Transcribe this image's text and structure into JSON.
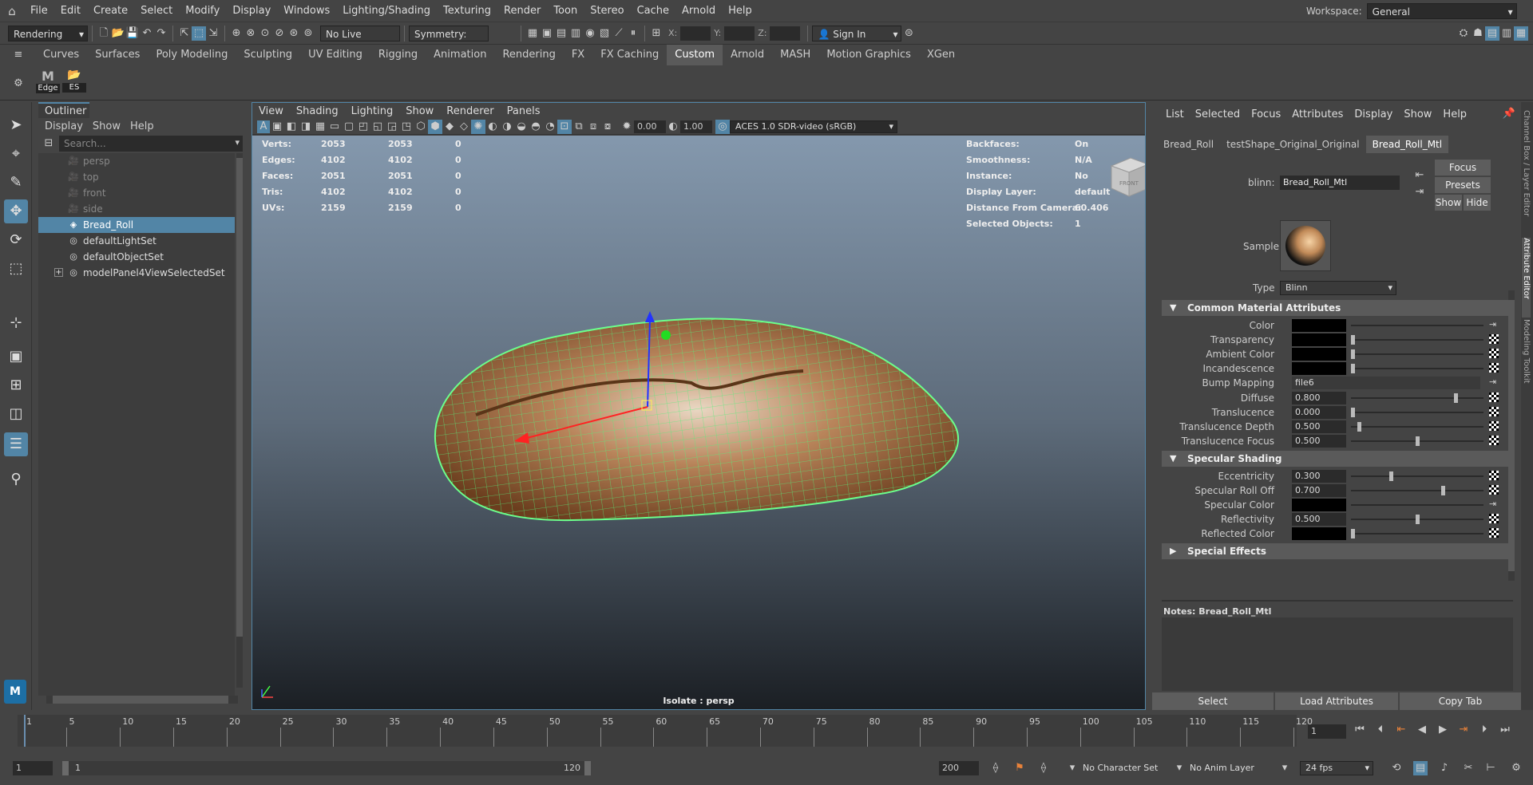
{
  "menubar": {
    "items": [
      "File",
      "Edit",
      "Create",
      "Select",
      "Modify",
      "Display",
      "Windows",
      "Lighting/Shading",
      "Texturing",
      "Render",
      "Toon",
      "Stereo",
      "Cache",
      "Arnold",
      "Help"
    ],
    "workspace_label": "Workspace:",
    "workspace_value": "General"
  },
  "statusline": {
    "menuset": "Rendering",
    "live_surface": "No Live Surface",
    "symmetry": "Symmetry: Off",
    "x_label": "X:",
    "y_label": "Y:",
    "z_label": "Z:",
    "sign_in": "Sign In"
  },
  "shelf": {
    "tabs": [
      "Curves",
      "Surfaces",
      "Poly Modeling",
      "Sculpting",
      "UV Editing",
      "Rigging",
      "Animation",
      "Rendering",
      "FX",
      "FX Caching",
      "Custom",
      "Arnold",
      "MASH",
      "Motion Graphics",
      "XGen"
    ],
    "active_tab": "Custom",
    "buttons": [
      {
        "label": "Edge",
        "glyph": "M"
      },
      {
        "label": "ES",
        "glyph": "📂"
      }
    ]
  },
  "outliner": {
    "title": "Outliner",
    "menu": [
      "Display",
      "Show",
      "Help"
    ],
    "search_placeholder": "Search...",
    "items": [
      {
        "label": "persp",
        "icon": "camera-icon",
        "dim": true
      },
      {
        "label": "top",
        "icon": "camera-icon",
        "dim": true
      },
      {
        "label": "front",
        "icon": "camera-icon",
        "dim": true
      },
      {
        "label": "side",
        "icon": "camera-icon",
        "dim": true
      },
      {
        "label": "Bread_Roll",
        "icon": "mesh-icon",
        "selected": true
      },
      {
        "label": "defaultLightSet",
        "icon": "set-icon"
      },
      {
        "label": "defaultObjectSet",
        "icon": "set-icon"
      },
      {
        "label": "modelPanel4ViewSelectedSet",
        "icon": "set-icon",
        "expand": true
      }
    ]
  },
  "viewport": {
    "menu": [
      "View",
      "Shading",
      "Lighting",
      "Show",
      "Renderer",
      "Panels"
    ],
    "exposure": "0.00",
    "gamma": "1.00",
    "colorspace": "ACES 1.0 SDR-video (sRGB)",
    "hud_left": [
      {
        "label": "Verts:",
        "a": "2053",
        "b": "2053",
        "c": "0"
      },
      {
        "label": "Edges:",
        "a": "4102",
        "b": "4102",
        "c": "0"
      },
      {
        "label": "Faces:",
        "a": "2051",
        "b": "2051",
        "c": "0"
      },
      {
        "label": "Tris:",
        "a": "4102",
        "b": "4102",
        "c": "0"
      },
      {
        "label": "UVs:",
        "a": "2159",
        "b": "2159",
        "c": "0"
      }
    ],
    "hud_right": [
      {
        "label": "Backfaces:",
        "value": "On"
      },
      {
        "label": "Smoothness:",
        "value": "N/A"
      },
      {
        "label": "Instance:",
        "value": "No"
      },
      {
        "label": "Display Layer:",
        "value": "default"
      },
      {
        "label": "Distance From Camera:",
        "value": "60.406"
      },
      {
        "label": "Selected Objects:",
        "value": "1"
      }
    ],
    "camera_label": "Isolate : persp",
    "viewcube_face": "FRONT"
  },
  "attr": {
    "menu": [
      "List",
      "Selected",
      "Focus",
      "Attributes",
      "Display",
      "Show",
      "Help"
    ],
    "tabs": [
      "Bread_Roll",
      "testShape_Original_Original",
      "Bread_Roll_Mtl"
    ],
    "active_tab": "Bread_Roll_Mtl",
    "node_type_label": "blinn:",
    "node_name": "Bread_Roll_Mtl",
    "focus": "Focus",
    "presets": "Presets",
    "show": "Show",
    "hide": "Hide",
    "sample_label": "Sample",
    "type_label": "Type",
    "type_value": "Blinn",
    "sections": [
      {
        "title": "Common Material Attributes",
        "rows": [
          {
            "label": "Color",
            "kind": "swatch"
          },
          {
            "label": "Transparency",
            "kind": "swatch",
            "slider": 0
          },
          {
            "label": "Ambient Color",
            "kind": "swatch",
            "slider": 0
          },
          {
            "label": "Incandescence",
            "kind": "swatch",
            "slider": 0
          },
          {
            "label": "Bump Mapping",
            "kind": "link",
            "value": "file6"
          },
          {
            "label": "Diffuse",
            "kind": "num",
            "value": "0.800",
            "slider": 0.8
          },
          {
            "label": "Translucence",
            "kind": "num",
            "value": "0.000",
            "slider": 0
          },
          {
            "label": "Translucence Depth",
            "kind": "num",
            "value": "0.500",
            "slider": 0.05
          },
          {
            "label": "Translucence Focus",
            "kind": "num",
            "value": "0.500",
            "slider": 0.5
          }
        ]
      },
      {
        "title": "Specular Shading",
        "rows": [
          {
            "label": "Eccentricity",
            "kind": "num",
            "value": "0.300",
            "slider": 0.3
          },
          {
            "label": "Specular Roll Off",
            "kind": "num",
            "value": "0.700",
            "slider": 0.7
          },
          {
            "label": "Specular Color",
            "kind": "swatch"
          },
          {
            "label": "Reflectivity",
            "kind": "num",
            "value": "0.500",
            "slider": 0.5
          },
          {
            "label": "Reflected Color",
            "kind": "swatch",
            "slider": 0
          }
        ]
      },
      {
        "title": "Special Effects",
        "rows": [],
        "collapsed": true
      }
    ],
    "notes_label": "Notes:  Bread_Roll_Mtl",
    "btn_select": "Select",
    "btn_load": "Load Attributes",
    "btn_copy": "Copy Tab",
    "side_tabs": [
      "Channel Box / Layer Editor",
      "Attribute Editor",
      "Modeling Toolkit"
    ]
  },
  "timeline": {
    "ticks": [
      "1",
      "5",
      "10",
      "15",
      "20",
      "25",
      "30",
      "35",
      "40",
      "45",
      "50",
      "55",
      "60",
      "65",
      "70",
      "75",
      "80",
      "85",
      "90",
      "95",
      "100",
      "105",
      "110",
      "115",
      "120"
    ],
    "current_frame": "1",
    "range_start": "1",
    "range_inner_start": "1",
    "range_inner_end": "120",
    "range_end": "200",
    "char_set": "No Character Set",
    "anim_layer": "No Anim Layer",
    "fps": "24 fps"
  }
}
